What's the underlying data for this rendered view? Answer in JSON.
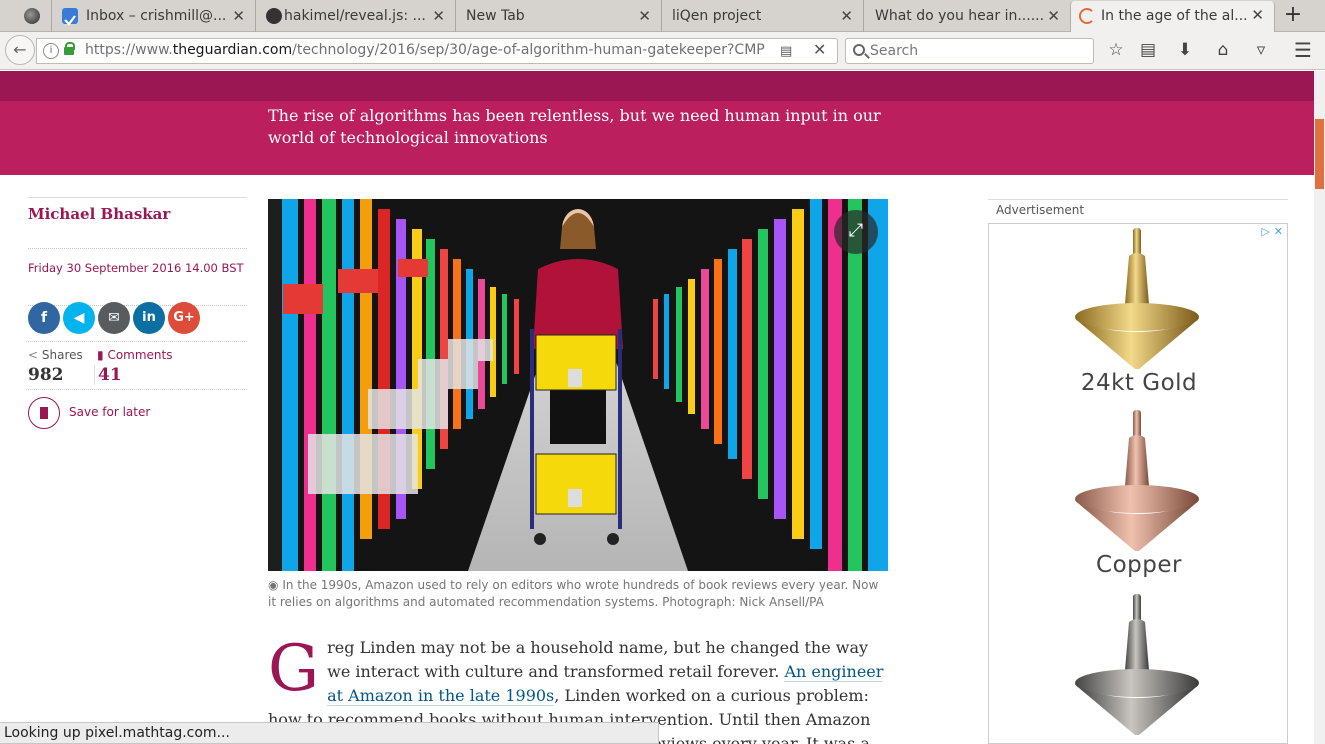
{
  "browser": {
    "tabs": [
      {
        "label": "",
        "icon": "gimp-icon"
      },
      {
        "label": "Inbox – crishmill@...",
        "icon": "inbox-icon"
      },
      {
        "label": "hakimel/reveal.js: ...",
        "icon": "github-icon"
      },
      {
        "label": "New Tab",
        "icon": ""
      },
      {
        "label": "liQen project",
        "icon": ""
      },
      {
        "label": "What do you hear in......",
        "icon": ""
      },
      {
        "label": "In the age of the al...",
        "icon": "loading-icon",
        "active": true
      }
    ],
    "new_tab_label": "+",
    "url": {
      "prefix": "https://www.",
      "domain": "theguardian.com",
      "path": "/technology/2016/sep/30/age-of-algorithm-human-gatekeeper?CMP"
    },
    "search_placeholder": "Search",
    "status_text": "Looking up pixel.mathtag.com..."
  },
  "article": {
    "standfirst": "The rise of algorithms has been relentless, but we need human input in our world of technological innovations",
    "author": "Michael Bhaskar",
    "date": "Friday 30 September 2016 14.00 BST",
    "shares_label": "Shares",
    "shares_count": "982",
    "comments_label": "Comments",
    "comments_count": "41",
    "save_label": "Save for later",
    "caption": "In the 1990s, Amazon used to rely on editors who wrote hundreds of book reviews every year. Now it relies on algorithms and automated recommendation systems. Photograph: Nick Ansell/PA",
    "dropcap": "G",
    "body_1": "reg Linden may not be a household name, but he changed the way we interact with culture and transformed retail forever. ",
    "body_link": "An engineer at Amazon in the late 1990s",
    "body_2": ", Linden worked on a curious problem: how to recommend books without human intervention. Until then Amazon relied on editors who wrote hundreds of book reviews every year. It was a costly and"
  },
  "ad": {
    "label": "Advertisement",
    "products": [
      "24kt Gold",
      "Copper"
    ]
  },
  "colors": {
    "brand": "#bb1f5e",
    "brand_dark": "#9b1753",
    "link": "#005689"
  }
}
